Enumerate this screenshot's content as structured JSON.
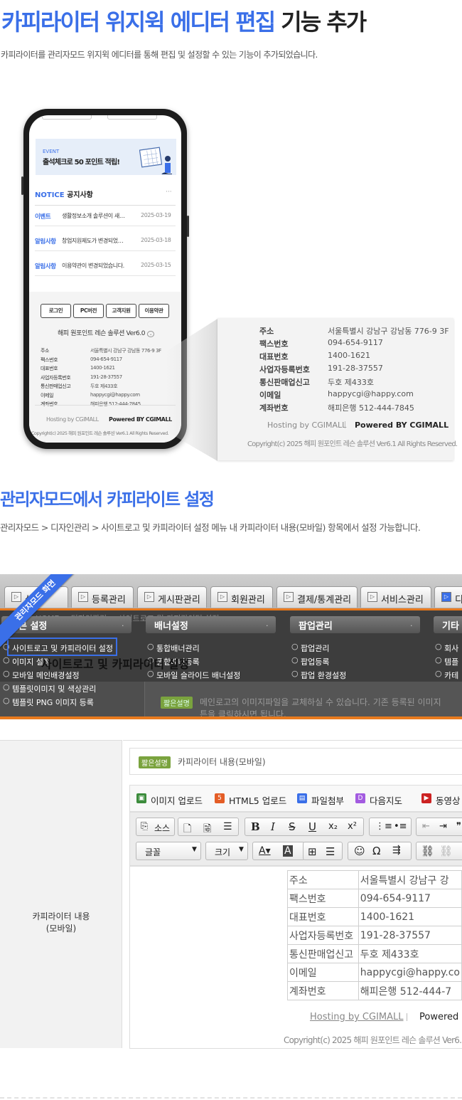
{
  "header": {
    "title_blue": "카피라이터 위지윅 에디터 편집",
    "title_black": "기능 추가",
    "description": "카피라이터를 관리자모드 위지윅 에디터를 통해 편집 및 설정할 수 있는 기능이 추가되었습니다."
  },
  "phone": {
    "banner_event": "EVENT",
    "banner_text": "출석체크로 50 포인트 적립!",
    "notice_en": "NOTICE",
    "notice_ko": "공지사항",
    "more": "···",
    "notices": [
      {
        "tag": "이벤트",
        "title": "생활정보소개 솔루션이 새…",
        "date": "2025-03-19"
      },
      {
        "tag": "알림사항",
        "title": "창업지원제도가 변경되었…",
        "date": "2025-03-18"
      },
      {
        "tag": "알림사항",
        "title": "이용약관이 변경되었습니다.",
        "date": "2025-03-15"
      }
    ],
    "buttons": [
      "로그인",
      "PC버전",
      "고객지원",
      "이용약관"
    ],
    "version": "해피 원포인트 레슨 솔루션 Ver6.0",
    "copyright": "Copyright(c) 2025 해피 원포인트 레슨 솔루션 Ver6.1 All Rights Reserved."
  },
  "copyright_info": {
    "rows": [
      {
        "label": "주소",
        "value": "서울특별시 강남구 강남동 776-9 3F"
      },
      {
        "label": "팩스번호",
        "value": "094-654-9117"
      },
      {
        "label": "대표번호",
        "value": "1400-1621"
      },
      {
        "label": "사업자등록번호",
        "value": "191-28-37557"
      },
      {
        "label": "통신판매업신고",
        "value": "두호 제433호"
      },
      {
        "label": "이메일",
        "value": "happycgi@happy.com"
      },
      {
        "label": "계좌번호",
        "value": "해피은행 512-444-7845"
      }
    ],
    "hosting": "Hosting by CGIMALL",
    "powered": "Powered BY CGIMALL",
    "copyright": "Copyright(c) 2025 해피 원포인트 레슨 솔루션 Ver6.1 All Rights Reserved."
  },
  "section2": {
    "title": "관리자모드에서 카피라이트 설정",
    "description": "관리자모드 > 디자인관리 > 사이트로고 및 카피라이터 설정 메뉴 내 카피라이터 내용(모바일) 항목에서 설정 가능합니다."
  },
  "admin": {
    "ribbon": "관리자모드 화면",
    "tabs": [
      "등록관리",
      "게시판관리",
      "회원관리",
      "결제/통계관리",
      "서비스관리",
      "디"
    ],
    "breadcrumb": "HOME > 디자인관리 > 사이트로고 및 카피라이터 설정",
    "menu_heads": [
      "기본 설정",
      "배너설정",
      "팝업관리",
      "기타"
    ],
    "col1": [
      "사이트로고 및 카피라이터 설정",
      "이미지 설정",
      "모바일 메인배경설정",
      "템플릿이미지 및 색상관리",
      "템플릿 PNG 이미지 등록"
    ],
    "col2": [
      "통합배너관리",
      "통합배너등록",
      "모바일 슬라이드 배너설정"
    ],
    "col3": [
      "팝업관리",
      "팝업등록",
      "팝업 환경설정"
    ],
    "col4": [
      "회사",
      "템플",
      "카테"
    ],
    "page_title": "사이트로고 및 카피라이터 설정",
    "help_badge": "짧은설명",
    "help_text": "메인로고의 이미지파일을 교체하실 수 있습니다. 기존 등록된 이미지",
    "help_text2": "튼을 클릭하시면 됩니다."
  },
  "editor": {
    "field_label": "카피라이터 내용\n(모바일)",
    "badge": "짧은설명",
    "field_desc": "카피라이터 내용(모바일)",
    "uploads": [
      "이미지 업로드",
      "HTML5 업로드",
      "파일첨부",
      "다음지도",
      "동영상"
    ],
    "source_btn": "소스",
    "font_select": "글꼴",
    "size_select": "크기",
    "rows": [
      {
        "label": "주소",
        "value": "서울특별시 강남구 강"
      },
      {
        "label": "팩스번호",
        "value": "094-654-9117"
      },
      {
        "label": "대표번호",
        "value": "1400-1621"
      },
      {
        "label": "사업자등록번호",
        "value": "191-28-37557"
      },
      {
        "label": "통신판매업신고",
        "value": "두호 제433호"
      },
      {
        "label": "이메일",
        "value": "happycgi@happy.co"
      },
      {
        "label": "계좌번호",
        "value": "해피은행 512-444-7"
      }
    ],
    "hosting": "Hosting by CGIMALL",
    "powered": "Powered BY",
    "copyright": "Copyright(c) 2025 해피 원포인트 레슨 솔루션 Ver6."
  }
}
